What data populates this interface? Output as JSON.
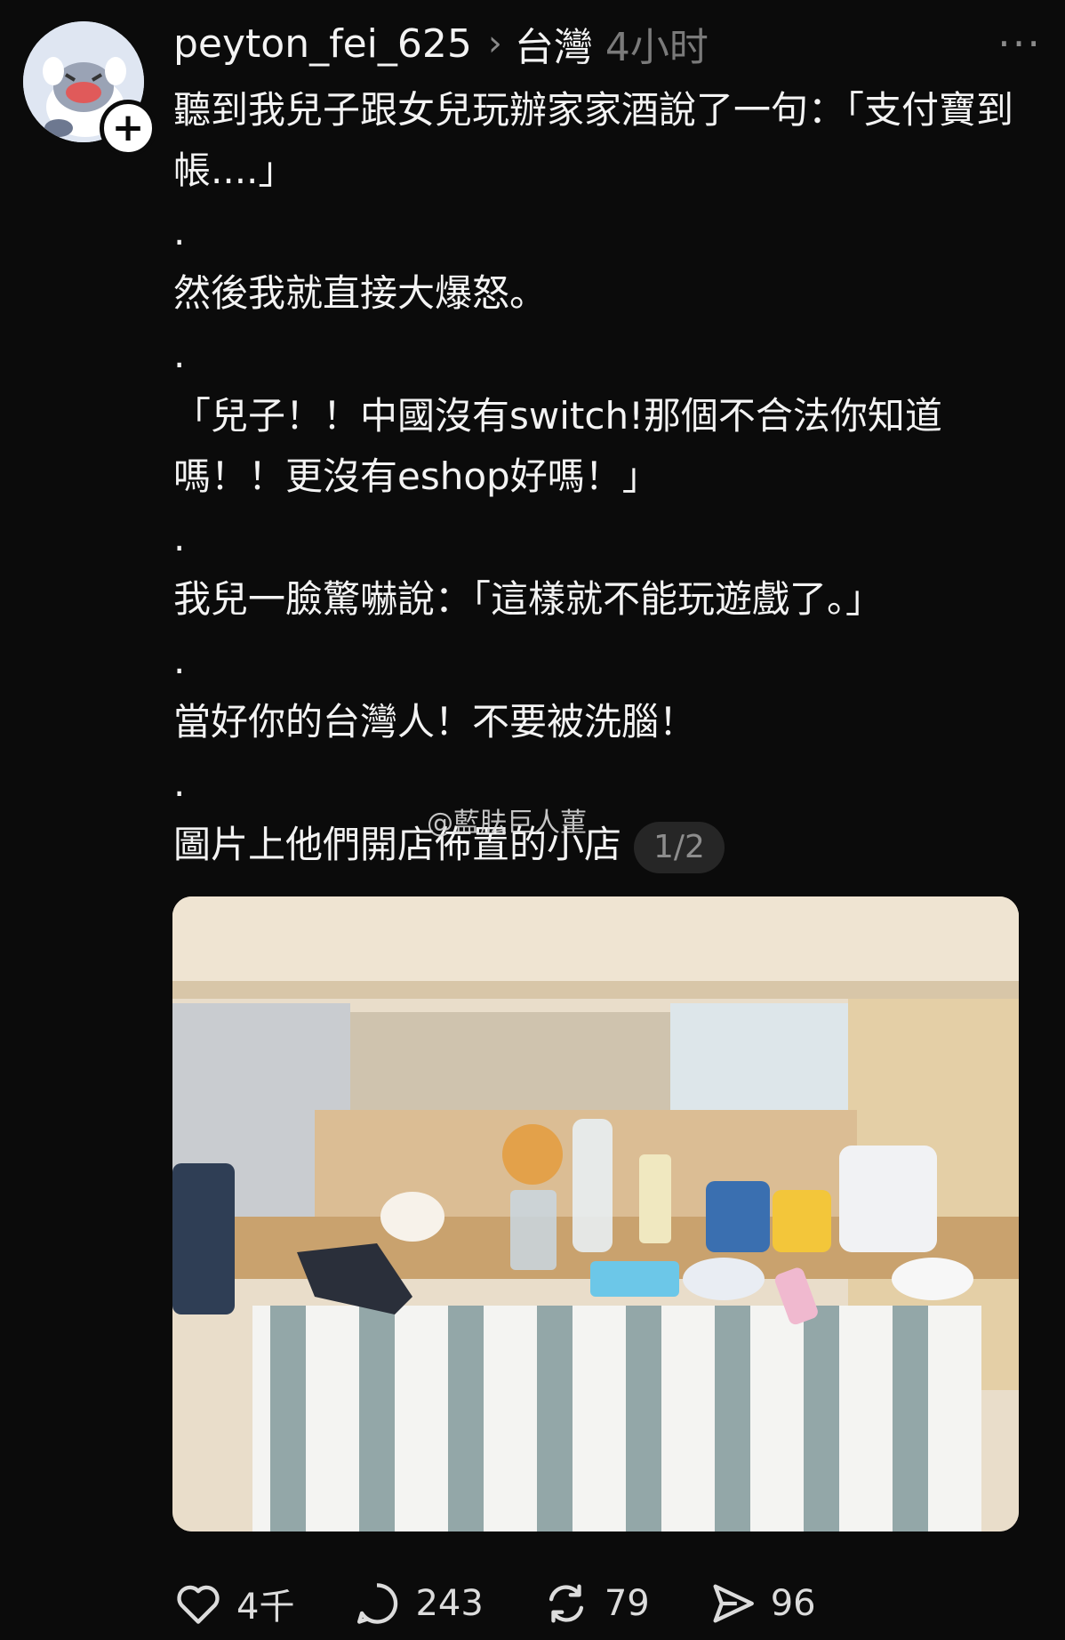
{
  "post": {
    "username": "peyton_fei_625",
    "topic": "台灣",
    "time": "4小时",
    "more_icon": "more-horizontal-icon",
    "lines": [
      "聽到我兒子跟女兒玩辦家家酒說了一句：「支付寶到帳....」",
      ".",
      "然後我就直接大爆怒。",
      ".",
      "「兒子！！中國沒有switch!那個不合法你知道嗎！！更沒有eshop好嗎！」",
      ".",
      "我兒一臉驚嚇說：「這樣就不能玩遊戲了。」",
      ".",
      "當好你的台灣人！不要被洗腦！",
      ".",
      "圖片上他們開店佈置的小店"
    ],
    "image_counter": "1/2",
    "watermark": "@藍胠巨人菫"
  },
  "actions": {
    "likes": "4千",
    "comments": "243",
    "reposts": "79",
    "shares": "96"
  },
  "colors": {
    "background": "#0b0b0b",
    "text": "#f3f3f3",
    "muted": "#7a7a7a"
  }
}
